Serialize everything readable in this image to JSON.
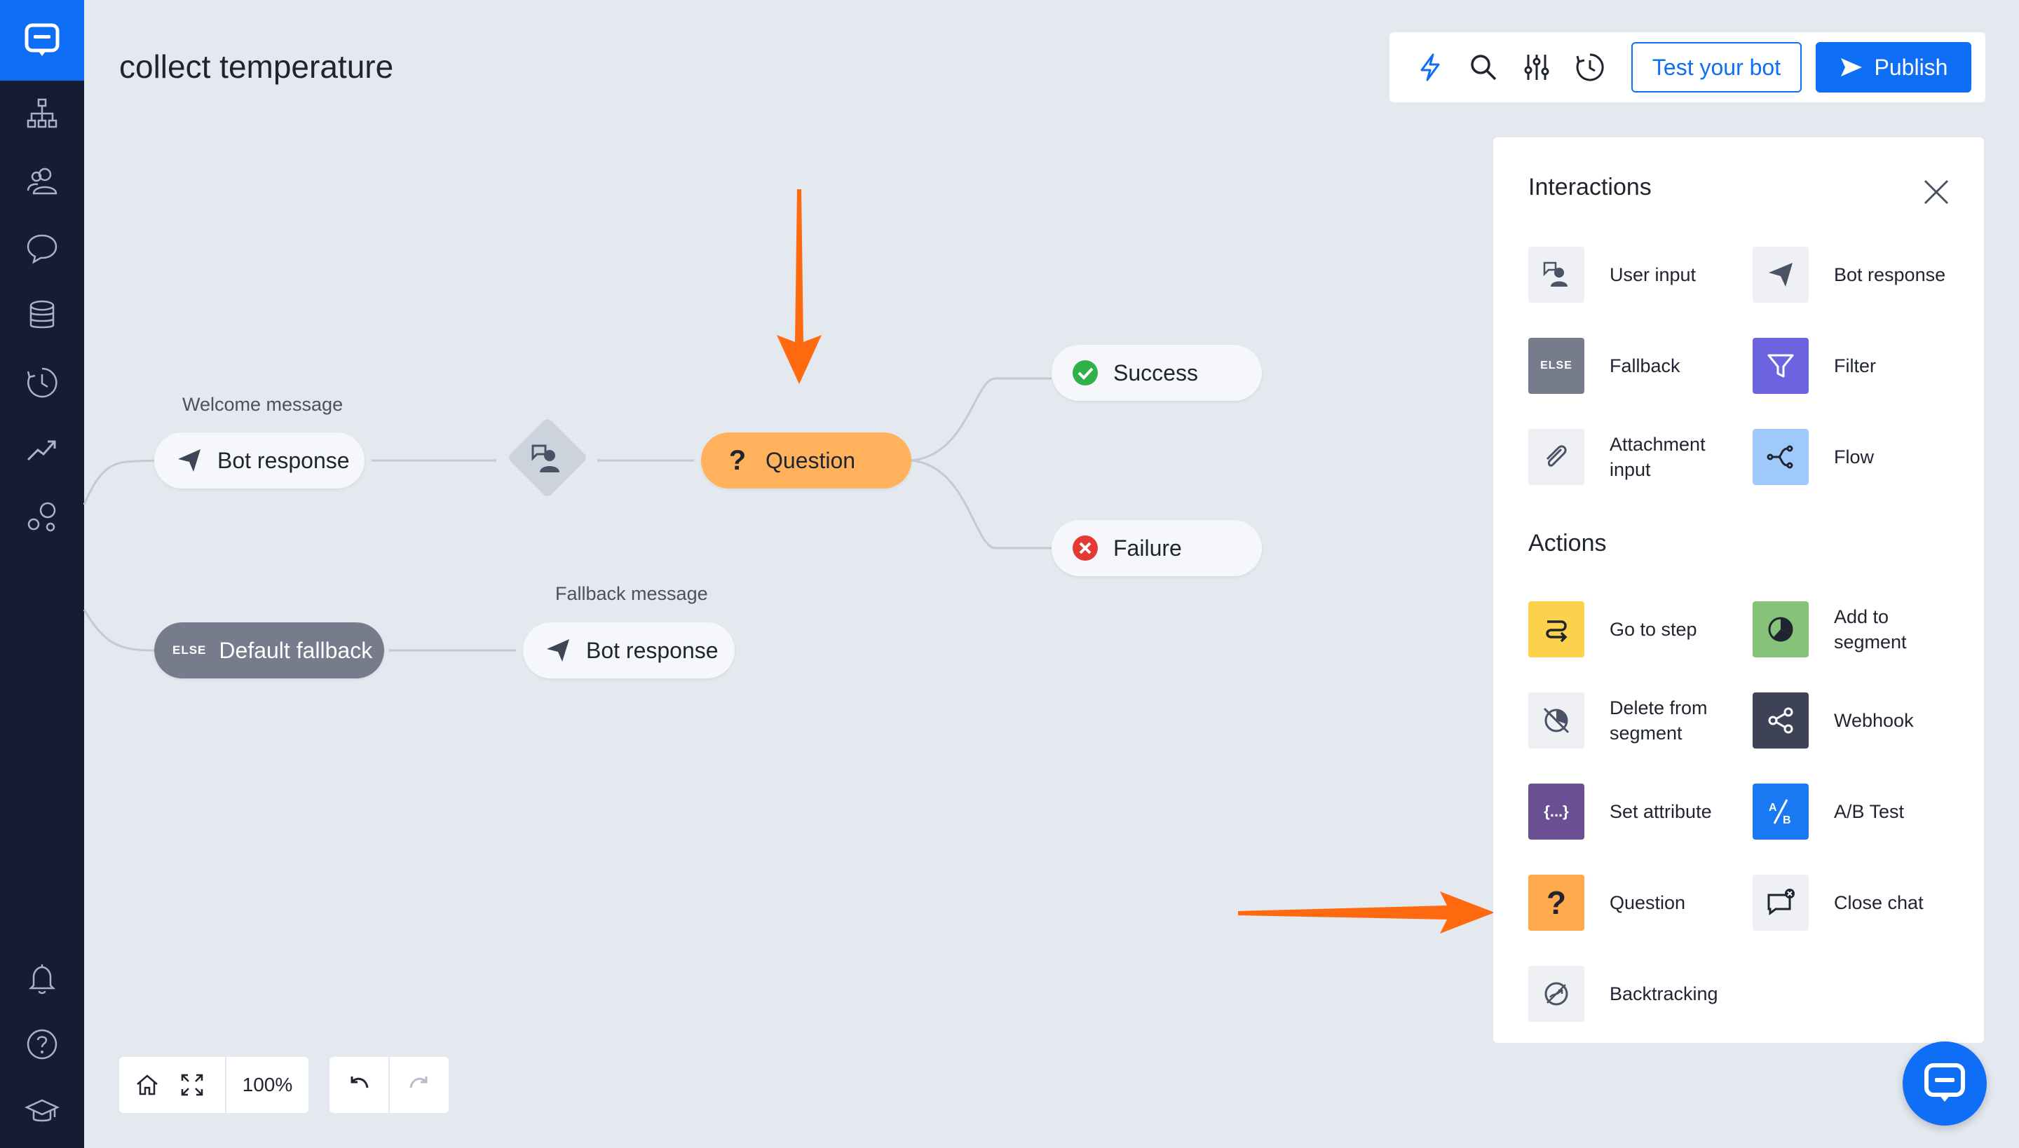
{
  "title": "collect temperature",
  "toolbar": {
    "icons": [
      "lightning-icon",
      "search-icon",
      "sliders-icon",
      "history-icon"
    ],
    "test_label": "Test your bot",
    "publish_label": "Publish"
  },
  "sidebar": {
    "icons": [
      "logo-icon",
      "flow-icon",
      "users-icon",
      "chat-icon",
      "database-icon",
      "clock-icon",
      "analytics-icon",
      "integrations-icon",
      "bell-icon",
      "help-icon",
      "academy-icon"
    ]
  },
  "canvas": {
    "welcome_label": "Welcome message",
    "bot_response_1": "Bot response",
    "question": "Question",
    "success": "Success",
    "failure": "Failure",
    "fallback_label": "Fallback message",
    "default_fallback": "Default fallback",
    "else_tag": "ELSE",
    "bot_response_2": "Bot response"
  },
  "panel": {
    "interactions_heading": "Interactions",
    "actions_heading": "Actions",
    "interactions": [
      {
        "label": "User input",
        "color": "#eef0f3"
      },
      {
        "label": "Bot response",
        "color": "#eef0f3"
      },
      {
        "label": "Fallback",
        "color": "#777c8d"
      },
      {
        "label": "Filter",
        "color": "#6c63e0"
      },
      {
        "label": "Attachment input",
        "color": "#eef0f3"
      },
      {
        "label": "Flow",
        "color": "#9fc9fb"
      }
    ],
    "actions": [
      {
        "label": "Go to step",
        "color": "#fcd24c"
      },
      {
        "label": "Add to segment",
        "color": "#86c277"
      },
      {
        "label": "Delete from segment",
        "color": "#eef0f3"
      },
      {
        "label": "Webhook",
        "color": "#3e4256"
      },
      {
        "label": "Set attribute",
        "color": "#6a4f92"
      },
      {
        "label": "A/B Test",
        "color": "#1a78f2"
      },
      {
        "label": "Question",
        "color": "#ffa94d"
      },
      {
        "label": "Close chat",
        "color": "#eef0f3"
      },
      {
        "label": "Backtracking",
        "color": "#eef0f3"
      }
    ]
  },
  "controls": {
    "zoom": "100%"
  },
  "colors": {
    "accent": "#0e6ef5",
    "sidebar": "#141d33",
    "question": "#ffb25b",
    "arrow": "#ff6a10",
    "success": "#2fb14a",
    "failure": "#e53935"
  }
}
